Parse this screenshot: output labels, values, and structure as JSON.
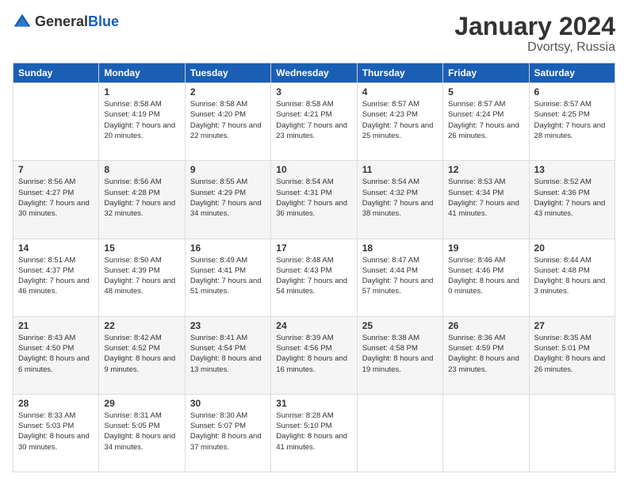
{
  "logo": {
    "general": "General",
    "blue": "Blue"
  },
  "header": {
    "title": "January 2024",
    "subtitle": "Dvortsy, Russia"
  },
  "weekdays": [
    "Sunday",
    "Monday",
    "Tuesday",
    "Wednesday",
    "Thursday",
    "Friday",
    "Saturday"
  ],
  "weeks": [
    [
      {
        "day": "",
        "sunrise": "",
        "sunset": "",
        "daylight": ""
      },
      {
        "day": "1",
        "sunrise": "Sunrise: 8:58 AM",
        "sunset": "Sunset: 4:19 PM",
        "daylight": "Daylight: 7 hours and 20 minutes."
      },
      {
        "day": "2",
        "sunrise": "Sunrise: 8:58 AM",
        "sunset": "Sunset: 4:20 PM",
        "daylight": "Daylight: 7 hours and 22 minutes."
      },
      {
        "day": "3",
        "sunrise": "Sunrise: 8:58 AM",
        "sunset": "Sunset: 4:21 PM",
        "daylight": "Daylight: 7 hours and 23 minutes."
      },
      {
        "day": "4",
        "sunrise": "Sunrise: 8:57 AM",
        "sunset": "Sunset: 4:23 PM",
        "daylight": "Daylight: 7 hours and 25 minutes."
      },
      {
        "day": "5",
        "sunrise": "Sunrise: 8:57 AM",
        "sunset": "Sunset: 4:24 PM",
        "daylight": "Daylight: 7 hours and 26 minutes."
      },
      {
        "day": "6",
        "sunrise": "Sunrise: 8:57 AM",
        "sunset": "Sunset: 4:25 PM",
        "daylight": "Daylight: 7 hours and 28 minutes."
      }
    ],
    [
      {
        "day": "7",
        "sunrise": "Sunrise: 8:56 AM",
        "sunset": "Sunset: 4:27 PM",
        "daylight": "Daylight: 7 hours and 30 minutes."
      },
      {
        "day": "8",
        "sunrise": "Sunrise: 8:56 AM",
        "sunset": "Sunset: 4:28 PM",
        "daylight": "Daylight: 7 hours and 32 minutes."
      },
      {
        "day": "9",
        "sunrise": "Sunrise: 8:55 AM",
        "sunset": "Sunset: 4:29 PM",
        "daylight": "Daylight: 7 hours and 34 minutes."
      },
      {
        "day": "10",
        "sunrise": "Sunrise: 8:54 AM",
        "sunset": "Sunset: 4:31 PM",
        "daylight": "Daylight: 7 hours and 36 minutes."
      },
      {
        "day": "11",
        "sunrise": "Sunrise: 8:54 AM",
        "sunset": "Sunset: 4:32 PM",
        "daylight": "Daylight: 7 hours and 38 minutes."
      },
      {
        "day": "12",
        "sunrise": "Sunrise: 8:53 AM",
        "sunset": "Sunset: 4:34 PM",
        "daylight": "Daylight: 7 hours and 41 minutes."
      },
      {
        "day": "13",
        "sunrise": "Sunrise: 8:52 AM",
        "sunset": "Sunset: 4:36 PM",
        "daylight": "Daylight: 7 hours and 43 minutes."
      }
    ],
    [
      {
        "day": "14",
        "sunrise": "Sunrise: 8:51 AM",
        "sunset": "Sunset: 4:37 PM",
        "daylight": "Daylight: 7 hours and 46 minutes."
      },
      {
        "day": "15",
        "sunrise": "Sunrise: 8:50 AM",
        "sunset": "Sunset: 4:39 PM",
        "daylight": "Daylight: 7 hours and 48 minutes."
      },
      {
        "day": "16",
        "sunrise": "Sunrise: 8:49 AM",
        "sunset": "Sunset: 4:41 PM",
        "daylight": "Daylight: 7 hours and 51 minutes."
      },
      {
        "day": "17",
        "sunrise": "Sunrise: 8:48 AM",
        "sunset": "Sunset: 4:43 PM",
        "daylight": "Daylight: 7 hours and 54 minutes."
      },
      {
        "day": "18",
        "sunrise": "Sunrise: 8:47 AM",
        "sunset": "Sunset: 4:44 PM",
        "daylight": "Daylight: 7 hours and 57 minutes."
      },
      {
        "day": "19",
        "sunrise": "Sunrise: 8:46 AM",
        "sunset": "Sunset: 4:46 PM",
        "daylight": "Daylight: 8 hours and 0 minutes."
      },
      {
        "day": "20",
        "sunrise": "Sunrise: 8:44 AM",
        "sunset": "Sunset: 4:48 PM",
        "daylight": "Daylight: 8 hours and 3 minutes."
      }
    ],
    [
      {
        "day": "21",
        "sunrise": "Sunrise: 8:43 AM",
        "sunset": "Sunset: 4:50 PM",
        "daylight": "Daylight: 8 hours and 6 minutes."
      },
      {
        "day": "22",
        "sunrise": "Sunrise: 8:42 AM",
        "sunset": "Sunset: 4:52 PM",
        "daylight": "Daylight: 8 hours and 9 minutes."
      },
      {
        "day": "23",
        "sunrise": "Sunrise: 8:41 AM",
        "sunset": "Sunset: 4:54 PM",
        "daylight": "Daylight: 8 hours and 13 minutes."
      },
      {
        "day": "24",
        "sunrise": "Sunrise: 8:39 AM",
        "sunset": "Sunset: 4:56 PM",
        "daylight": "Daylight: 8 hours and 16 minutes."
      },
      {
        "day": "25",
        "sunrise": "Sunrise: 8:38 AM",
        "sunset": "Sunset: 4:58 PM",
        "daylight": "Daylight: 8 hours and 19 minutes."
      },
      {
        "day": "26",
        "sunrise": "Sunrise: 8:36 AM",
        "sunset": "Sunset: 4:59 PM",
        "daylight": "Daylight: 8 hours and 23 minutes."
      },
      {
        "day": "27",
        "sunrise": "Sunrise: 8:35 AM",
        "sunset": "Sunset: 5:01 PM",
        "daylight": "Daylight: 8 hours and 26 minutes."
      }
    ],
    [
      {
        "day": "28",
        "sunrise": "Sunrise: 8:33 AM",
        "sunset": "Sunset: 5:03 PM",
        "daylight": "Daylight: 8 hours and 30 minutes."
      },
      {
        "day": "29",
        "sunrise": "Sunrise: 8:31 AM",
        "sunset": "Sunset: 5:05 PM",
        "daylight": "Daylight: 8 hours and 34 minutes."
      },
      {
        "day": "30",
        "sunrise": "Sunrise: 8:30 AM",
        "sunset": "Sunset: 5:07 PM",
        "daylight": "Daylight: 8 hours and 37 minutes."
      },
      {
        "day": "31",
        "sunrise": "Sunrise: 8:28 AM",
        "sunset": "Sunset: 5:10 PM",
        "daylight": "Daylight: 8 hours and 41 minutes."
      },
      {
        "day": "",
        "sunrise": "",
        "sunset": "",
        "daylight": ""
      },
      {
        "day": "",
        "sunrise": "",
        "sunset": "",
        "daylight": ""
      },
      {
        "day": "",
        "sunrise": "",
        "sunset": "",
        "daylight": ""
      }
    ]
  ]
}
